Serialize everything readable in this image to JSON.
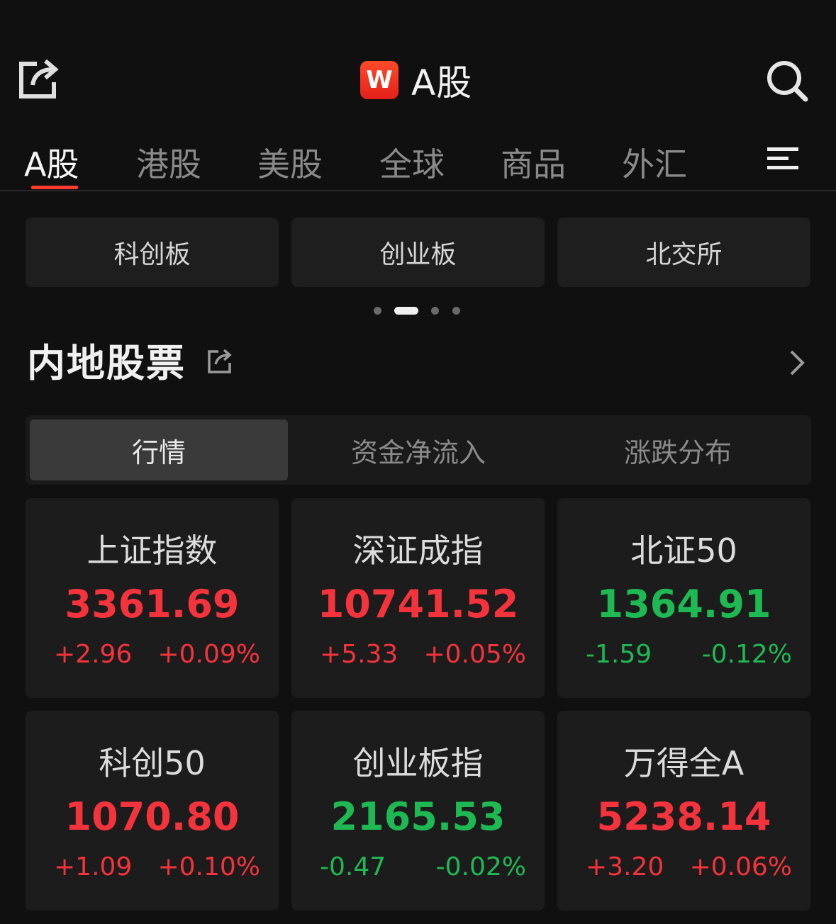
{
  "header": {
    "title": "A股",
    "logo_letter": "W"
  },
  "tabs": [
    {
      "label": "A股",
      "active": true
    },
    {
      "label": "港股"
    },
    {
      "label": "美股"
    },
    {
      "label": "全球"
    },
    {
      "label": "商品"
    },
    {
      "label": "外汇"
    }
  ],
  "quick_links": [
    "科创板",
    "创业板",
    "北交所"
  ],
  "pager": {
    "count": 4,
    "active_index": 1
  },
  "section": {
    "title": "内地股票"
  },
  "segments": [
    {
      "label": "行情",
      "active": true
    },
    {
      "label": "资金净流入"
    },
    {
      "label": "涨跌分布"
    }
  ],
  "colors": {
    "up": "#f4333c",
    "down": "#1fb954",
    "accent": "#ff3b30"
  },
  "indices": [
    {
      "name": "上证指数",
      "value": "3361.69",
      "change": "+2.96",
      "pct": "+0.09%",
      "dir": "up"
    },
    {
      "name": "深证成指",
      "value": "10741.52",
      "change": "+5.33",
      "pct": "+0.05%",
      "dir": "up"
    },
    {
      "name": "北证50",
      "value": "1364.91",
      "change": "-1.59",
      "pct": "-0.12%",
      "dir": "down"
    },
    {
      "name": "科创50",
      "value": "1070.80",
      "change": "+1.09",
      "pct": "+0.10%",
      "dir": "up"
    },
    {
      "name": "创业板指",
      "value": "2165.53",
      "change": "-0.47",
      "pct": "-0.02%",
      "dir": "down"
    },
    {
      "name": "万得全A",
      "value": "5238.14",
      "change": "+3.20",
      "pct": "+0.06%",
      "dir": "up"
    }
  ]
}
